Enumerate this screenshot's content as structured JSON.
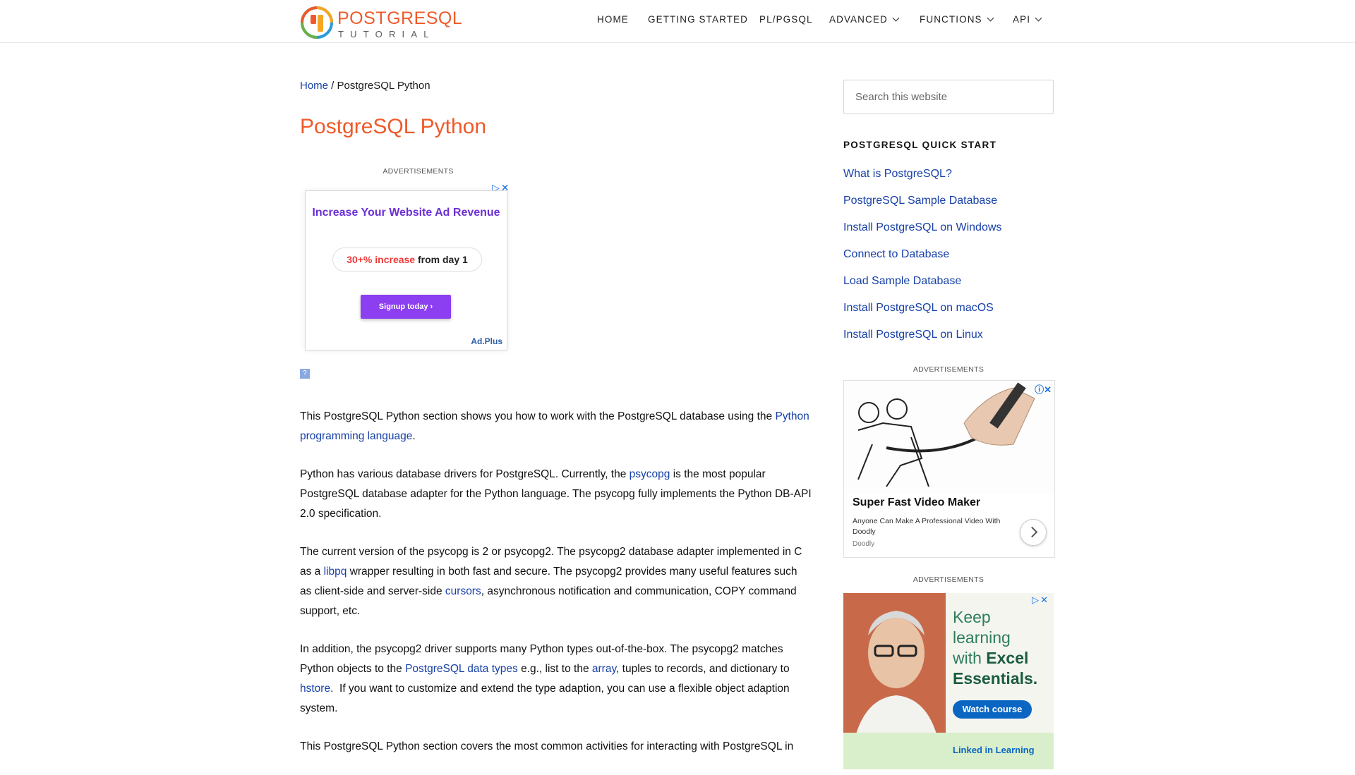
{
  "logo": {
    "title": "POSTGRESQL",
    "subtitle": "TUTORIAL"
  },
  "nav": {
    "items": [
      {
        "label": "HOME"
      },
      {
        "label": "GETTING STARTED"
      },
      {
        "label": "PL/PGSQL"
      },
      {
        "label": "ADVANCED"
      },
      {
        "label": "FUNCTIONS"
      },
      {
        "label": "API"
      }
    ]
  },
  "breadcrumb": {
    "home": "Home",
    "sep": " / ",
    "current": "PostgreSQL Python"
  },
  "page_title": "PostgreSQL Python",
  "ads": {
    "label": "ADVERTISEMENTS",
    "ad1": {
      "headline": "Increase Your Website Ad Revenue",
      "pill_highlight": "30+% increase",
      "pill_rest": " from day 1",
      "button": "Signup today ›",
      "brand": "Ad.Plus",
      "help": "?"
    },
    "ad2": {
      "title": "Super Fast Video Maker",
      "desc": "Anyone Can Make A Professional Video With Doodly",
      "source": "Doodly"
    },
    "ad3": {
      "line1": "Keep",
      "line2": "learning",
      "line3": "with",
      "line3_bold": "Excel",
      "line4": "Essentials.",
      "button": "Watch course",
      "brand": "Linked in Learning"
    }
  },
  "article": {
    "p1": {
      "t1": "This PostgreSQL Python section shows you how to work with the PostgreSQL database using the ",
      "l1": "Python programming language",
      "t2": "."
    },
    "p2": {
      "t1": "Python has various database drivers for PostgreSQL. Currently, the ",
      "l1": "psycopg",
      "t2": " is the most popular PostgreSQL database adapter for the Python language. The psycopg fully implements the Python DB-API 2.0 specification."
    },
    "p3": {
      "t1": "The current version of the psycopg is 2 or psycopg2. The psycopg2 database adapter implemented in C as a ",
      "l1": "libpq",
      "t2": " wrapper resulting in both fast and secure. The psycopg2 provides many useful features such as client-side and server-side ",
      "l2": "cursors",
      "t3": ", asynchronous notification and communication, COPY command support, etc."
    },
    "p4": {
      "t1": "In addition, the psycopg2 driver supports many Python types out-of-the-box. The psycopg2 matches Python objects to the ",
      "l1": "PostgreSQL data types",
      "t2": " e.g., list to the ",
      "l2": "array",
      "t3": ", tuples to records, and dictionary to ",
      "l3": "hstore",
      "t4": ".  If you want to customize and extend the type adaption, you can use a flexible object adaption system."
    },
    "p5": {
      "t1": "This PostgreSQL Python section covers the most common activities for interacting with PostgreSQL in"
    }
  },
  "sidebar": {
    "search_placeholder": "Search this website",
    "heading": "POSTGRESQL QUICK START",
    "links": [
      "What is PostgreSQL?",
      "PostgreSQL Sample Database",
      "Install PostgreSQL on Windows",
      "Connect to Database",
      "Load Sample Database",
      "Install PostgreSQL on macOS",
      "Install PostgreSQL on Linux"
    ]
  }
}
